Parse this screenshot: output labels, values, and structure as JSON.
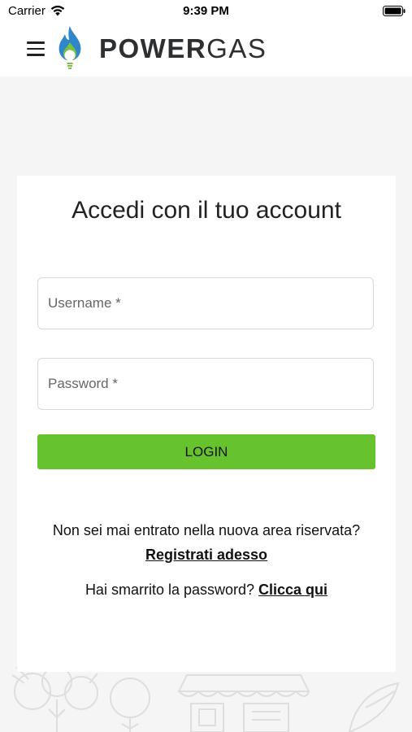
{
  "status_bar": {
    "carrier": "Carrier",
    "time": "9:39 PM",
    "wifi_icon": "wifi-icon",
    "battery_icon": "battery-icon"
  },
  "header": {
    "menu_icon": "hamburger-menu-icon",
    "logo_icon": "flame-bulb-logo-icon",
    "brand_bold": "POWER",
    "brand_light": "GAS"
  },
  "login": {
    "title": "Accedi con il tuo account",
    "username_placeholder": "Username *",
    "username_value": "",
    "password_placeholder": "Password *",
    "password_value": "",
    "login_button": "LOGIN",
    "register_question": "Non sei mai entrato nella nuova area riservata?",
    "register_link": "Registrati adesso",
    "forgot_text": "Hai smarrito la password?",
    "forgot_link": "Clicca qui"
  },
  "colors": {
    "accent_green": "#66c32e",
    "logo_blue": "#2f86c9",
    "logo_green": "#7cc242",
    "background": "#f5f5f5",
    "card": "#ffffff"
  }
}
